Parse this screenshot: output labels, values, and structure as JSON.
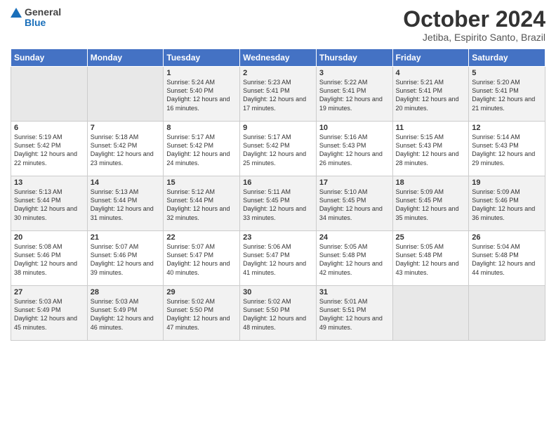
{
  "header": {
    "logo_general": "General",
    "logo_blue": "Blue",
    "month_title": "October 2024",
    "subtitle": "Jetiba, Espirito Santo, Brazil"
  },
  "days_of_week": [
    "Sunday",
    "Monday",
    "Tuesday",
    "Wednesday",
    "Thursday",
    "Friday",
    "Saturday"
  ],
  "weeks": [
    [
      {
        "day": "",
        "empty": true
      },
      {
        "day": "",
        "empty": true
      },
      {
        "day": "1",
        "sunrise": "Sunrise: 5:24 AM",
        "sunset": "Sunset: 5:40 PM",
        "daylight": "Daylight: 12 hours and 16 minutes."
      },
      {
        "day": "2",
        "sunrise": "Sunrise: 5:23 AM",
        "sunset": "Sunset: 5:41 PM",
        "daylight": "Daylight: 12 hours and 17 minutes."
      },
      {
        "day": "3",
        "sunrise": "Sunrise: 5:22 AM",
        "sunset": "Sunset: 5:41 PM",
        "daylight": "Daylight: 12 hours and 19 minutes."
      },
      {
        "day": "4",
        "sunrise": "Sunrise: 5:21 AM",
        "sunset": "Sunset: 5:41 PM",
        "daylight": "Daylight: 12 hours and 20 minutes."
      },
      {
        "day": "5",
        "sunrise": "Sunrise: 5:20 AM",
        "sunset": "Sunset: 5:41 PM",
        "daylight": "Daylight: 12 hours and 21 minutes."
      }
    ],
    [
      {
        "day": "6",
        "sunrise": "Sunrise: 5:19 AM",
        "sunset": "Sunset: 5:42 PM",
        "daylight": "Daylight: 12 hours and 22 minutes."
      },
      {
        "day": "7",
        "sunrise": "Sunrise: 5:18 AM",
        "sunset": "Sunset: 5:42 PM",
        "daylight": "Daylight: 12 hours and 23 minutes."
      },
      {
        "day": "8",
        "sunrise": "Sunrise: 5:17 AM",
        "sunset": "Sunset: 5:42 PM",
        "daylight": "Daylight: 12 hours and 24 minutes."
      },
      {
        "day": "9",
        "sunrise": "Sunrise: 5:17 AM",
        "sunset": "Sunset: 5:42 PM",
        "daylight": "Daylight: 12 hours and 25 minutes."
      },
      {
        "day": "10",
        "sunrise": "Sunrise: 5:16 AM",
        "sunset": "Sunset: 5:43 PM",
        "daylight": "Daylight: 12 hours and 26 minutes."
      },
      {
        "day": "11",
        "sunrise": "Sunrise: 5:15 AM",
        "sunset": "Sunset: 5:43 PM",
        "daylight": "Daylight: 12 hours and 28 minutes."
      },
      {
        "day": "12",
        "sunrise": "Sunrise: 5:14 AM",
        "sunset": "Sunset: 5:43 PM",
        "daylight": "Daylight: 12 hours and 29 minutes."
      }
    ],
    [
      {
        "day": "13",
        "sunrise": "Sunrise: 5:13 AM",
        "sunset": "Sunset: 5:44 PM",
        "daylight": "Daylight: 12 hours and 30 minutes."
      },
      {
        "day": "14",
        "sunrise": "Sunrise: 5:13 AM",
        "sunset": "Sunset: 5:44 PM",
        "daylight": "Daylight: 12 hours and 31 minutes."
      },
      {
        "day": "15",
        "sunrise": "Sunrise: 5:12 AM",
        "sunset": "Sunset: 5:44 PM",
        "daylight": "Daylight: 12 hours and 32 minutes."
      },
      {
        "day": "16",
        "sunrise": "Sunrise: 5:11 AM",
        "sunset": "Sunset: 5:45 PM",
        "daylight": "Daylight: 12 hours and 33 minutes."
      },
      {
        "day": "17",
        "sunrise": "Sunrise: 5:10 AM",
        "sunset": "Sunset: 5:45 PM",
        "daylight": "Daylight: 12 hours and 34 minutes."
      },
      {
        "day": "18",
        "sunrise": "Sunrise: 5:09 AM",
        "sunset": "Sunset: 5:45 PM",
        "daylight": "Daylight: 12 hours and 35 minutes."
      },
      {
        "day": "19",
        "sunrise": "Sunrise: 5:09 AM",
        "sunset": "Sunset: 5:46 PM",
        "daylight": "Daylight: 12 hours and 36 minutes."
      }
    ],
    [
      {
        "day": "20",
        "sunrise": "Sunrise: 5:08 AM",
        "sunset": "Sunset: 5:46 PM",
        "daylight": "Daylight: 12 hours and 38 minutes."
      },
      {
        "day": "21",
        "sunrise": "Sunrise: 5:07 AM",
        "sunset": "Sunset: 5:46 PM",
        "daylight": "Daylight: 12 hours and 39 minutes."
      },
      {
        "day": "22",
        "sunrise": "Sunrise: 5:07 AM",
        "sunset": "Sunset: 5:47 PM",
        "daylight": "Daylight: 12 hours and 40 minutes."
      },
      {
        "day": "23",
        "sunrise": "Sunrise: 5:06 AM",
        "sunset": "Sunset: 5:47 PM",
        "daylight": "Daylight: 12 hours and 41 minutes."
      },
      {
        "day": "24",
        "sunrise": "Sunrise: 5:05 AM",
        "sunset": "Sunset: 5:48 PM",
        "daylight": "Daylight: 12 hours and 42 minutes."
      },
      {
        "day": "25",
        "sunrise": "Sunrise: 5:05 AM",
        "sunset": "Sunset: 5:48 PM",
        "daylight": "Daylight: 12 hours and 43 minutes."
      },
      {
        "day": "26",
        "sunrise": "Sunrise: 5:04 AM",
        "sunset": "Sunset: 5:48 PM",
        "daylight": "Daylight: 12 hours and 44 minutes."
      }
    ],
    [
      {
        "day": "27",
        "sunrise": "Sunrise: 5:03 AM",
        "sunset": "Sunset: 5:49 PM",
        "daylight": "Daylight: 12 hours and 45 minutes."
      },
      {
        "day": "28",
        "sunrise": "Sunrise: 5:03 AM",
        "sunset": "Sunset: 5:49 PM",
        "daylight": "Daylight: 12 hours and 46 minutes."
      },
      {
        "day": "29",
        "sunrise": "Sunrise: 5:02 AM",
        "sunset": "Sunset: 5:50 PM",
        "daylight": "Daylight: 12 hours and 47 minutes."
      },
      {
        "day": "30",
        "sunrise": "Sunrise: 5:02 AM",
        "sunset": "Sunset: 5:50 PM",
        "daylight": "Daylight: 12 hours and 48 minutes."
      },
      {
        "day": "31",
        "sunrise": "Sunrise: 5:01 AM",
        "sunset": "Sunset: 5:51 PM",
        "daylight": "Daylight: 12 hours and 49 minutes."
      },
      {
        "day": "",
        "empty": true
      },
      {
        "day": "",
        "empty": true
      }
    ]
  ]
}
